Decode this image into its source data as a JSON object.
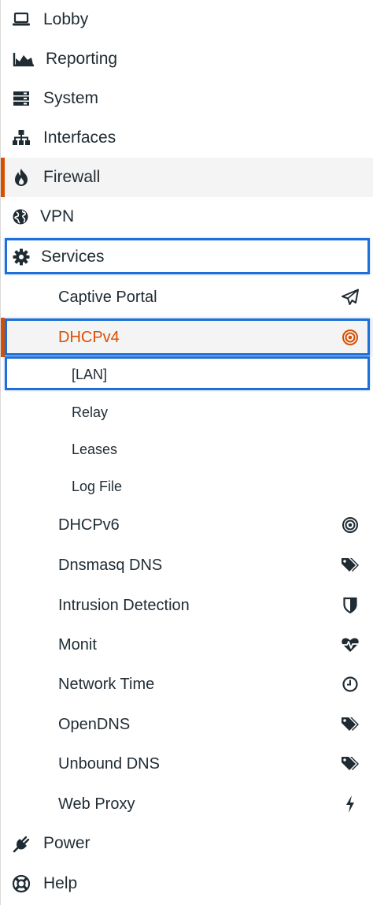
{
  "accent_color": "#d94f00",
  "highlight_color": "#1e6fd9",
  "menu": {
    "lobby": {
      "label": "Lobby",
      "icon": "laptop-icon"
    },
    "reporting": {
      "label": "Reporting",
      "icon": "area-chart-icon"
    },
    "system": {
      "label": "System",
      "icon": "server-icon"
    },
    "interfaces": {
      "label": "Interfaces",
      "icon": "sitemap-icon"
    },
    "firewall": {
      "label": "Firewall",
      "icon": "fire-icon"
    },
    "vpn": {
      "label": "VPN",
      "icon": "globe-icon"
    },
    "services": {
      "label": "Services",
      "icon": "gear-icon"
    },
    "power": {
      "label": "Power",
      "icon": "plug-icon"
    },
    "help": {
      "label": "Help",
      "icon": "lifebuoy-icon"
    }
  },
  "services": {
    "captive_portal": {
      "label": "Captive Portal",
      "icon": "paper-plane-icon"
    },
    "dhcpv4": {
      "label": "DHCPv4",
      "icon": "bullseye-icon"
    },
    "dhcpv4_children": {
      "lan": "[LAN]",
      "relay": "Relay",
      "leases": "Leases",
      "log_file": "Log File"
    },
    "dhcpv6": {
      "label": "DHCPv6",
      "icon": "bullseye-icon"
    },
    "dnsmasq": {
      "label": "Dnsmasq DNS",
      "icon": "tags-icon"
    },
    "ids": {
      "label": "Intrusion Detection",
      "icon": "shield-icon"
    },
    "monit": {
      "label": "Monit",
      "icon": "heartbeat-icon"
    },
    "ntp": {
      "label": "Network Time",
      "icon": "clock-icon"
    },
    "opendns": {
      "label": "OpenDNS",
      "icon": "tags-icon"
    },
    "unbound": {
      "label": "Unbound DNS",
      "icon": "tags-icon"
    },
    "web_proxy": {
      "label": "Web Proxy",
      "icon": "bolt-icon"
    }
  }
}
